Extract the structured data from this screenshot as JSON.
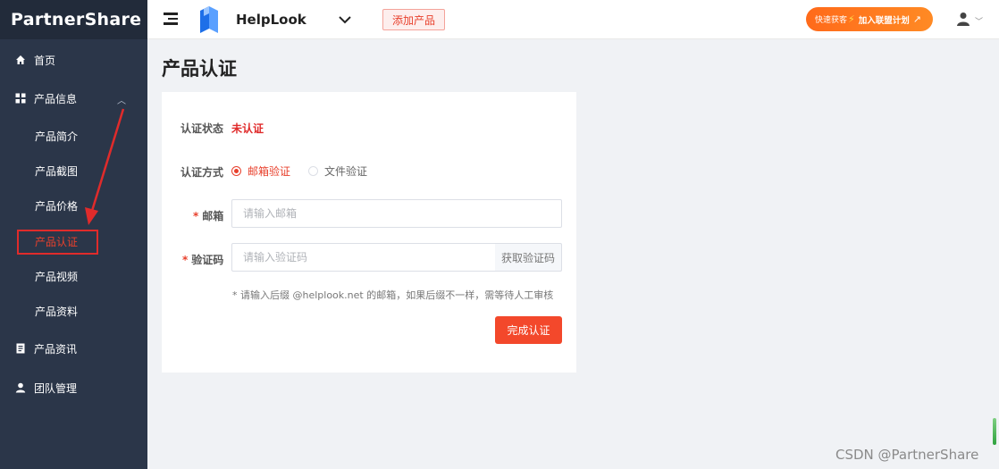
{
  "brand": {
    "logo_text": "PartnerShare"
  },
  "topbar": {
    "product_name": "HelpLook",
    "add_product_label": "添加产品",
    "promo_prefix": "快速获客",
    "promo_strong": "加入联盟计划"
  },
  "sidebar": {
    "items": [
      {
        "label": "首页",
        "icon": "home-icon"
      },
      {
        "label": "产品信息",
        "icon": "grid-icon",
        "expanded": true
      },
      {
        "label": "产品资讯",
        "icon": "document-icon"
      },
      {
        "label": "团队管理",
        "icon": "user-icon"
      }
    ],
    "sub_items": [
      {
        "label": "产品简介"
      },
      {
        "label": "产品截图"
      },
      {
        "label": "产品价格"
      },
      {
        "label": "产品认证",
        "active": true
      },
      {
        "label": "产品视频"
      },
      {
        "label": "产品资料"
      }
    ]
  },
  "page": {
    "title": "产品认证"
  },
  "form": {
    "status_label": "认证状态",
    "status_value": "未认证",
    "method_label": "认证方式",
    "method_options": [
      "邮箱验证",
      "文件验证"
    ],
    "method_selected": "邮箱验证",
    "email_label": "邮箱",
    "email_placeholder": "请输入邮箱",
    "email_value": "",
    "code_label": "验证码",
    "code_placeholder": "请输入验证码",
    "code_value": "",
    "get_code_label": "获取验证码",
    "hint": "* 请输入后缀 @helplook.net 的邮箱，如果后缀不一样，需等待人工审核",
    "submit_label": "完成认证",
    "required_mark": "*"
  },
  "watermark": "CSDN @PartnerShare",
  "colors": {
    "accent": "#e8402c",
    "sidebar_bg": "#2b3649",
    "promo": "#ff7a1f"
  }
}
